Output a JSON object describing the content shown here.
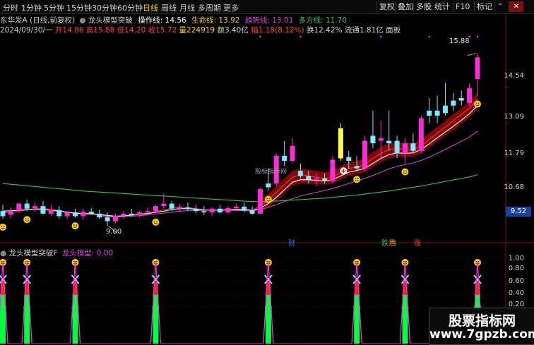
{
  "toolbar": {
    "periods": [
      "分时",
      "1分钟",
      "5分钟",
      "15分钟",
      "30分钟",
      "60分钟",
      "日线",
      "周线",
      "月线",
      "多周期",
      "更多"
    ],
    "active_period": "日线",
    "right_buttons": [
      "复权",
      "叠加",
      "多股",
      "统计",
      "F10",
      "标记"
    ],
    "up_icon": "⌃",
    "close_icon": "✕"
  },
  "header": {
    "stock_name": "东华发A",
    "adjust_mode": "(日线,前复权)",
    "indicator_name": "龙头模型突破",
    "op_label": "操作线: 14.56",
    "life_label": "生命线: 13.92",
    "trend_label": "趋势线: 13.01",
    "long_label": "多方线: 11.70"
  },
  "quote": {
    "date": "2024/09/30/一",
    "open": "开14.86",
    "high": "高15.88",
    "low": "低14.20",
    "close": "收15.72",
    "volume": "量224919",
    "amount": "额3.40亿",
    "change": "幅1.18(8.12%)",
    "turnover": "换12.42%",
    "float_cap": "流通1.81亿",
    "board": "面板"
  },
  "price_axis": {
    "labels": [
      "14.54",
      "13.09",
      "11.79",
      "10.68"
    ],
    "current": "9.52"
  },
  "annotations": {
    "high_value": "15.88",
    "low_value": "9.00",
    "watermark_mid": "股标指标网",
    "cai": "财",
    "die": "跌",
    "teng": "腾",
    "zhang": "涨"
  },
  "sub_panel": {
    "name": "龙头模型突破F",
    "label": "龙头模型: 0.00",
    "axis": [
      "1.00",
      "0.80",
      "0.60",
      "0.40",
      "0.20"
    ]
  },
  "watermark": {
    "line1": "股票指标网",
    "line2": "www.7gpzb.com"
  },
  "chart_data": {
    "type": "candlestick",
    "title": "",
    "ylim": [
      8.4,
      16.6
    ],
    "candles": [
      {
        "o": 9.6,
        "h": 9.85,
        "l": 9.3,
        "c": 9.4,
        "k": "c"
      },
      {
        "o": 9.45,
        "h": 9.75,
        "l": 9.3,
        "c": 9.62,
        "k": "m"
      },
      {
        "o": 9.62,
        "h": 9.95,
        "l": 9.55,
        "c": 9.9,
        "k": "m"
      },
      {
        "o": 9.9,
        "h": 10.05,
        "l": 9.6,
        "c": 9.7,
        "k": "c"
      },
      {
        "o": 9.72,
        "h": 9.95,
        "l": 9.55,
        "c": 9.8,
        "k": "m"
      },
      {
        "o": 9.8,
        "h": 10.0,
        "l": 9.45,
        "c": 9.5,
        "k": "c"
      },
      {
        "o": 9.5,
        "h": 9.85,
        "l": 9.4,
        "c": 9.65,
        "k": "m"
      },
      {
        "o": 9.65,
        "h": 9.8,
        "l": 9.3,
        "c": 9.4,
        "k": "c"
      },
      {
        "o": 9.4,
        "h": 9.62,
        "l": 9.28,
        "c": 9.55,
        "k": "m"
      },
      {
        "o": 9.55,
        "h": 9.7,
        "l": 9.35,
        "c": 9.4,
        "k": "c"
      },
      {
        "o": 9.4,
        "h": 9.7,
        "l": 9.25,
        "c": 9.58,
        "k": "m"
      },
      {
        "o": 9.58,
        "h": 9.72,
        "l": 9.45,
        "c": 9.5,
        "k": "c"
      },
      {
        "o": 9.5,
        "h": 9.65,
        "l": 9.3,
        "c": 9.35,
        "k": "c"
      },
      {
        "o": 9.35,
        "h": 9.55,
        "l": 9.0,
        "c": 9.2,
        "k": "c"
      },
      {
        "o": 9.2,
        "h": 9.5,
        "l": 9.1,
        "c": 9.42,
        "k": "m"
      },
      {
        "o": 9.42,
        "h": 9.6,
        "l": 9.3,
        "c": 9.5,
        "k": "m"
      },
      {
        "o": 9.5,
        "h": 9.7,
        "l": 9.4,
        "c": 9.45,
        "k": "c"
      },
      {
        "o": 9.45,
        "h": 9.6,
        "l": 9.35,
        "c": 9.55,
        "k": "m"
      },
      {
        "o": 9.55,
        "h": 9.75,
        "l": 9.45,
        "c": 9.6,
        "k": "m"
      },
      {
        "o": 9.6,
        "h": 9.85,
        "l": 9.5,
        "c": 9.8,
        "k": "m"
      },
      {
        "o": 9.8,
        "h": 10.3,
        "l": 9.7,
        "c": 9.9,
        "k": "m"
      },
      {
        "o": 9.9,
        "h": 10.0,
        "l": 9.6,
        "c": 9.7,
        "k": "c"
      },
      {
        "o": 9.7,
        "h": 9.9,
        "l": 9.55,
        "c": 9.75,
        "k": "m"
      },
      {
        "o": 9.75,
        "h": 9.95,
        "l": 9.6,
        "c": 9.68,
        "k": "c"
      },
      {
        "o": 9.68,
        "h": 9.85,
        "l": 9.5,
        "c": 9.6,
        "k": "c"
      },
      {
        "o": 9.6,
        "h": 9.8,
        "l": 9.45,
        "c": 9.55,
        "k": "c"
      },
      {
        "o": 9.55,
        "h": 9.75,
        "l": 9.4,
        "c": 9.7,
        "k": "m"
      },
      {
        "o": 9.7,
        "h": 9.85,
        "l": 9.5,
        "c": 9.55,
        "k": "c"
      },
      {
        "o": 9.55,
        "h": 9.8,
        "l": 9.5,
        "c": 9.72,
        "k": "m"
      },
      {
        "o": 9.72,
        "h": 9.9,
        "l": 9.6,
        "c": 9.78,
        "k": "m"
      },
      {
        "o": 9.78,
        "h": 9.95,
        "l": 9.55,
        "c": 9.62,
        "k": "c"
      },
      {
        "o": 9.62,
        "h": 9.8,
        "l": 9.45,
        "c": 9.5,
        "k": "c"
      },
      {
        "o": 9.5,
        "h": 10.52,
        "l": 9.48,
        "c": 10.48,
        "k": "m"
      },
      {
        "o": 10.55,
        "h": 11.3,
        "l": 10.4,
        "c": 10.7,
        "k": "c"
      },
      {
        "o": 10.7,
        "h": 11.9,
        "l": 10.6,
        "c": 11.8,
        "k": "m"
      },
      {
        "o": 11.8,
        "h": 12.4,
        "l": 11.4,
        "c": 11.6,
        "k": "c"
      },
      {
        "o": 11.6,
        "h": 12.5,
        "l": 11.5,
        "c": 12.2,
        "k": "m"
      },
      {
        "o": 11.2,
        "h": 11.5,
        "l": 10.9,
        "c": 11.0,
        "k": "c"
      },
      {
        "o": 11.0,
        "h": 11.2,
        "l": 10.7,
        "c": 10.85,
        "k": "c"
      },
      {
        "o": 10.85,
        "h": 11.1,
        "l": 10.6,
        "c": 10.9,
        "k": "m"
      },
      {
        "o": 10.9,
        "h": 11.1,
        "l": 10.7,
        "c": 10.8,
        "k": "c"
      },
      {
        "o": 10.8,
        "h": 11.8,
        "l": 10.7,
        "c": 11.65,
        "k": "m"
      },
      {
        "o": 11.7,
        "h": 13.1,
        "l": 11.6,
        "c": 12.9,
        "k": "y"
      },
      {
        "o": 11.6,
        "h": 12.0,
        "l": 11.3,
        "c": 11.75,
        "k": "c"
      },
      {
        "o": 11.4,
        "h": 11.8,
        "l": 11.2,
        "c": 11.3,
        "k": "c"
      },
      {
        "o": 11.3,
        "h": 12.6,
        "l": 11.2,
        "c": 12.4,
        "k": "m"
      },
      {
        "o": 12.3,
        "h": 13.6,
        "l": 12.1,
        "c": 12.6,
        "k": "c"
      },
      {
        "o": 12.5,
        "h": 13.2,
        "l": 11.7,
        "c": 12.4,
        "k": "m"
      },
      {
        "o": 12.3,
        "h": 13.6,
        "l": 12.0,
        "c": 12.4,
        "k": "c"
      },
      {
        "o": 12.4,
        "h": 12.6,
        "l": 11.7,
        "c": 11.9,
        "k": "c"
      },
      {
        "o": 11.9,
        "h": 12.5,
        "l": 11.5,
        "c": 12.3,
        "k": "m"
      },
      {
        "o": 12.3,
        "h": 12.7,
        "l": 11.9,
        "c": 12.0,
        "k": "c"
      },
      {
        "o": 12.0,
        "h": 13.4,
        "l": 11.9,
        "c": 13.3,
        "k": "m"
      },
      {
        "o": 13.4,
        "h": 14.1,
        "l": 13.1,
        "c": 13.6,
        "k": "c"
      },
      {
        "o": 13.6,
        "h": 14.2,
        "l": 13.1,
        "c": 13.4,
        "k": "c"
      },
      {
        "o": 13.5,
        "h": 14.7,
        "l": 13.4,
        "c": 13.8,
        "k": "c"
      },
      {
        "o": 13.8,
        "h": 14.3,
        "l": 13.6,
        "c": 14.0,
        "k": "c"
      },
      {
        "o": 14.0,
        "h": 14.4,
        "l": 13.8,
        "c": 14.1,
        "k": "c"
      },
      {
        "o": 13.9,
        "h": 14.7,
        "l": 13.8,
        "c": 14.5,
        "k": "m"
      },
      {
        "o": 14.86,
        "h": 15.88,
        "l": 14.2,
        "c": 15.72,
        "k": "m"
      }
    ],
    "ma": [
      {
        "name": "",
        "color": "#ff3030",
        "values": [
          9.52,
          9.55,
          9.6,
          9.65,
          9.7,
          9.7,
          9.68,
          9.62,
          9.55,
          9.5,
          9.48,
          9.48,
          9.45,
          9.4,
          9.38,
          9.4,
          9.44,
          9.48,
          9.52,
          9.58,
          9.65,
          9.72,
          9.76,
          9.74,
          9.7,
          9.66,
          9.64,
          9.65,
          9.66,
          9.68,
          9.68,
          9.64,
          9.8,
          10.05,
          10.35,
          10.65,
          10.95,
          11.05,
          11.0,
          10.95,
          10.9,
          10.95,
          11.15,
          11.3,
          11.35,
          11.45,
          11.7,
          11.9,
          12.05,
          12.1,
          12.05,
          12.05,
          12.2,
          12.45,
          12.7,
          12.95,
          13.2,
          13.45,
          13.7,
          14.05
        ]
      },
      {
        "name": "",
        "color": "#ffffff",
        "values": [
          9.6,
          9.62,
          9.63,
          9.66,
          9.68,
          9.66,
          9.63,
          9.6,
          9.56,
          9.52,
          9.5,
          9.5,
          9.47,
          9.43,
          9.4,
          9.41,
          9.44,
          9.47,
          9.5,
          9.55,
          9.6,
          9.66,
          9.7,
          9.7,
          9.68,
          9.65,
          9.63,
          9.64,
          9.65,
          9.66,
          9.66,
          9.62,
          9.72,
          9.9,
          10.15,
          10.45,
          10.75,
          10.85,
          10.85,
          10.82,
          10.8,
          10.85,
          11.0,
          11.15,
          11.22,
          11.3,
          11.5,
          11.7,
          11.85,
          11.92,
          11.9,
          11.92,
          12.05,
          12.28,
          12.52,
          12.75,
          12.98,
          13.22,
          13.48,
          13.8
        ]
      },
      {
        "name": "",
        "color": "#d040d0",
        "values": [
          null,
          null,
          null,
          null,
          null,
          null,
          null,
          null,
          null,
          null,
          null,
          null,
          9.4,
          9.38,
          9.37,
          9.38,
          9.4,
          9.42,
          9.45,
          9.48,
          9.52,
          9.56,
          9.6,
          9.62,
          9.63,
          9.63,
          9.63,
          9.63,
          9.63,
          9.63,
          9.62,
          9.61,
          9.66,
          9.75,
          9.86,
          9.98,
          10.1,
          10.2,
          10.28,
          10.35,
          10.42,
          10.5,
          10.6,
          10.7,
          10.8,
          10.9,
          11.02,
          11.15,
          11.28,
          11.38,
          11.45,
          11.52,
          11.62,
          11.75,
          11.9,
          12.05,
          12.22,
          12.38,
          12.55,
          12.78
        ]
      },
      {
        "name": "",
        "color": "#2ecc40",
        "values": [
          10.7,
          10.67,
          10.64,
          10.61,
          10.58,
          10.55,
          10.52,
          10.49,
          10.46,
          10.43,
          10.4,
          10.38,
          10.36,
          10.34,
          10.32,
          10.3,
          10.28,
          10.26,
          10.24,
          10.22,
          10.2,
          10.18,
          10.16,
          10.14,
          10.12,
          10.1,
          10.08,
          10.06,
          10.04,
          10.02,
          10.0,
          9.98,
          9.98,
          9.99,
          10.0,
          10.02,
          10.04,
          10.06,
          10.08,
          10.1,
          10.12,
          10.15,
          10.18,
          10.21,
          10.24,
          10.28,
          10.32,
          10.36,
          10.4,
          10.45,
          10.5,
          10.55,
          10.6,
          10.66,
          10.72,
          10.78,
          10.84,
          10.9,
          10.96,
          11.05
        ]
      }
    ],
    "signals": [
      {
        "i": 0
      },
      {
        "i": 3
      },
      {
        "i": 9
      },
      {
        "i": 19
      },
      {
        "i": 33
      },
      {
        "i": 44
      },
      {
        "i": 50
      },
      {
        "i": 59
      }
    ]
  }
}
